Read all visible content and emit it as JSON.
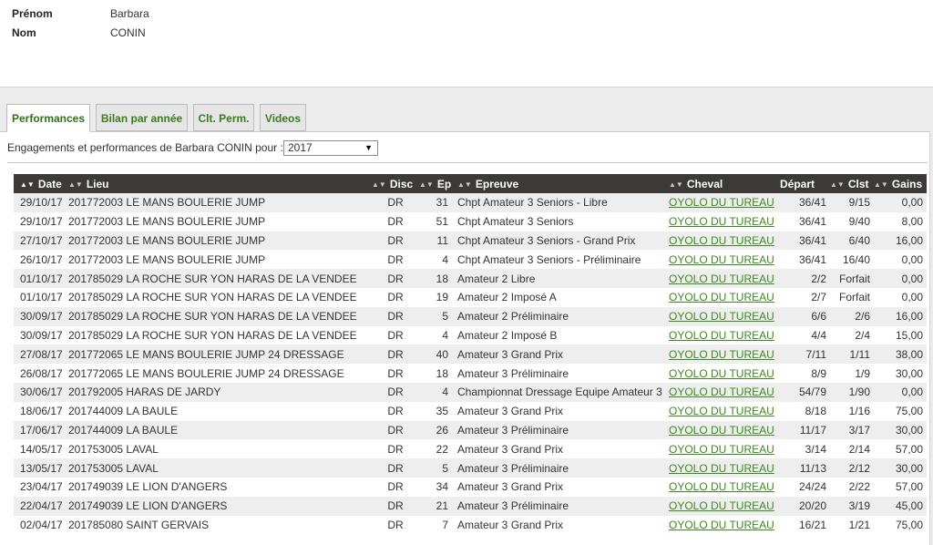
{
  "person": {
    "first_name_label": "Prénom",
    "first_name": "Barbara",
    "last_name_label": "Nom",
    "last_name": "CONIN"
  },
  "tabs": [
    {
      "label": "Performances",
      "active": true
    },
    {
      "label": "Bilan par année",
      "active": false
    },
    {
      "label": "Clt. Perm.",
      "active": false
    },
    {
      "label": "Videos",
      "active": false
    }
  ],
  "filter": {
    "label": "Engagements et performances de Barbara CONIN pour :",
    "year": "2017"
  },
  "table": {
    "columns": [
      "Date",
      "Lieu",
      "Disc",
      "Ep",
      "Epreuve",
      "Cheval",
      "Départ",
      "Clst",
      "Gains"
    ],
    "rows": [
      {
        "date": "29/10/17",
        "lieu": "201772003 LE MANS BOULERIE JUMP",
        "disc": "DR",
        "ep": "31",
        "epreuve": "Chpt Amateur 3 Seniors - Libre",
        "cheval": "OYOLO DU TUREAU",
        "depart": "36/41",
        "clst": "9/15",
        "gains": "0,00"
      },
      {
        "date": "29/10/17",
        "lieu": "201772003 LE MANS BOULERIE JUMP",
        "disc": "DR",
        "ep": "51",
        "epreuve": "Chpt Amateur 3 Seniors",
        "cheval": "OYOLO DU TUREAU",
        "depart": "36/41",
        "clst": "9/40",
        "gains": "8,00"
      },
      {
        "date": "27/10/17",
        "lieu": "201772003 LE MANS BOULERIE JUMP",
        "disc": "DR",
        "ep": "11",
        "epreuve": "Chpt Amateur 3 Seniors - Grand Prix",
        "cheval": "OYOLO DU TUREAU",
        "depart": "36/41",
        "clst": "6/40",
        "gains": "16,00"
      },
      {
        "date": "26/10/17",
        "lieu": "201772003 LE MANS BOULERIE JUMP",
        "disc": "DR",
        "ep": "4",
        "epreuve": "Chpt Amateur 3 Seniors - Préliminaire",
        "cheval": "OYOLO DU TUREAU",
        "depart": "36/41",
        "clst": "16/40",
        "gains": "0,00"
      },
      {
        "date": "01/10/17",
        "lieu": "201785029 LA ROCHE SUR YON HARAS DE LA VENDEE",
        "disc": "DR",
        "ep": "18",
        "epreuve": "Amateur 2 Libre",
        "cheval": "OYOLO DU TUREAU",
        "depart": "2/2",
        "clst": "Forfait",
        "gains": "0,00"
      },
      {
        "date": "01/10/17",
        "lieu": "201785029 LA ROCHE SUR YON HARAS DE LA VENDEE",
        "disc": "DR",
        "ep": "19",
        "epreuve": "Amateur 2 Imposé A",
        "cheval": "OYOLO DU TUREAU",
        "depart": "2/7",
        "clst": "Forfait",
        "gains": "0,00"
      },
      {
        "date": "30/09/17",
        "lieu": "201785029 LA ROCHE SUR YON HARAS DE LA VENDEE",
        "disc": "DR",
        "ep": "5",
        "epreuve": "Amateur 2 Préliminaire",
        "cheval": "OYOLO DU TUREAU",
        "depart": "6/6",
        "clst": "2/6",
        "gains": "16,00"
      },
      {
        "date": "30/09/17",
        "lieu": "201785029 LA ROCHE SUR YON HARAS DE LA VENDEE",
        "disc": "DR",
        "ep": "4",
        "epreuve": "Amateur 2 Imposé B",
        "cheval": "OYOLO DU TUREAU",
        "depart": "4/4",
        "clst": "2/4",
        "gains": "15,00"
      },
      {
        "date": "27/08/17",
        "lieu": "201772065 LE MANS BOULERIE JUMP 24 DRESSAGE",
        "disc": "DR",
        "ep": "40",
        "epreuve": "Amateur 3 Grand Prix",
        "cheval": "OYOLO DU TUREAU",
        "depart": "7/11",
        "clst": "1/11",
        "gains": "38,00"
      },
      {
        "date": "26/08/17",
        "lieu": "201772065 LE MANS BOULERIE JUMP 24 DRESSAGE",
        "disc": "DR",
        "ep": "18",
        "epreuve": "Amateur 3 Préliminaire",
        "cheval": "OYOLO DU TUREAU",
        "depart": "8/9",
        "clst": "1/9",
        "gains": "30,00"
      },
      {
        "date": "30/06/17",
        "lieu": "201792005 HARAS DE JARDY",
        "disc": "DR",
        "ep": "4",
        "epreuve": "Championnat Dressage Equipe Amateur 3",
        "cheval": "OYOLO DU TUREAU",
        "depart": "54/79",
        "clst": "1/90",
        "gains": "0,00"
      },
      {
        "date": "18/06/17",
        "lieu": "201744009 LA BAULE",
        "disc": "DR",
        "ep": "35",
        "epreuve": "Amateur 3 Grand Prix",
        "cheval": "OYOLO DU TUREAU",
        "depart": "8/18",
        "clst": "1/16",
        "gains": "75,00"
      },
      {
        "date": "17/06/17",
        "lieu": "201744009 LA BAULE",
        "disc": "DR",
        "ep": "26",
        "epreuve": "Amateur 3 Préliminaire",
        "cheval": "OYOLO DU TUREAU",
        "depart": "11/17",
        "clst": "3/17",
        "gains": "30,00"
      },
      {
        "date": "14/05/17",
        "lieu": "201753005 LAVAL",
        "disc": "DR",
        "ep": "22",
        "epreuve": "Amateur 3 Grand Prix",
        "cheval": "OYOLO DU TUREAU",
        "depart": "3/14",
        "clst": "2/14",
        "gains": "57,00"
      },
      {
        "date": "13/05/17",
        "lieu": "201753005 LAVAL",
        "disc": "DR",
        "ep": "5",
        "epreuve": "Amateur 3 Préliminaire",
        "cheval": "OYOLO DU TUREAU",
        "depart": "11/13",
        "clst": "2/12",
        "gains": "30,00"
      },
      {
        "date": "23/04/17",
        "lieu": "201749039 LE LION D'ANGERS",
        "disc": "DR",
        "ep": "34",
        "epreuve": "Amateur 3 Grand Prix",
        "cheval": "OYOLO DU TUREAU",
        "depart": "24/24",
        "clst": "2/22",
        "gains": "57,00"
      },
      {
        "date": "22/04/17",
        "lieu": "201749039 LE LION D'ANGERS",
        "disc": "DR",
        "ep": "21",
        "epreuve": "Amateur 3 Préliminaire",
        "cheval": "OYOLO DU TUREAU",
        "depart": "20/20",
        "clst": "3/19",
        "gains": "45,00"
      },
      {
        "date": "02/04/17",
        "lieu": "201785080 SAINT GERVAIS",
        "disc": "DR",
        "ep": "7",
        "epreuve": "Amateur 3 Grand Prix",
        "cheval": "OYOLO DU TUREAU",
        "depart": "16/21",
        "clst": "1/21",
        "gains": "75,00"
      }
    ]
  },
  "colors": {
    "header_bg": "#3c3937",
    "link_green": "#3c8a1f",
    "tab_text": "#3b7d1e",
    "row_alt": "#eeeeee"
  }
}
